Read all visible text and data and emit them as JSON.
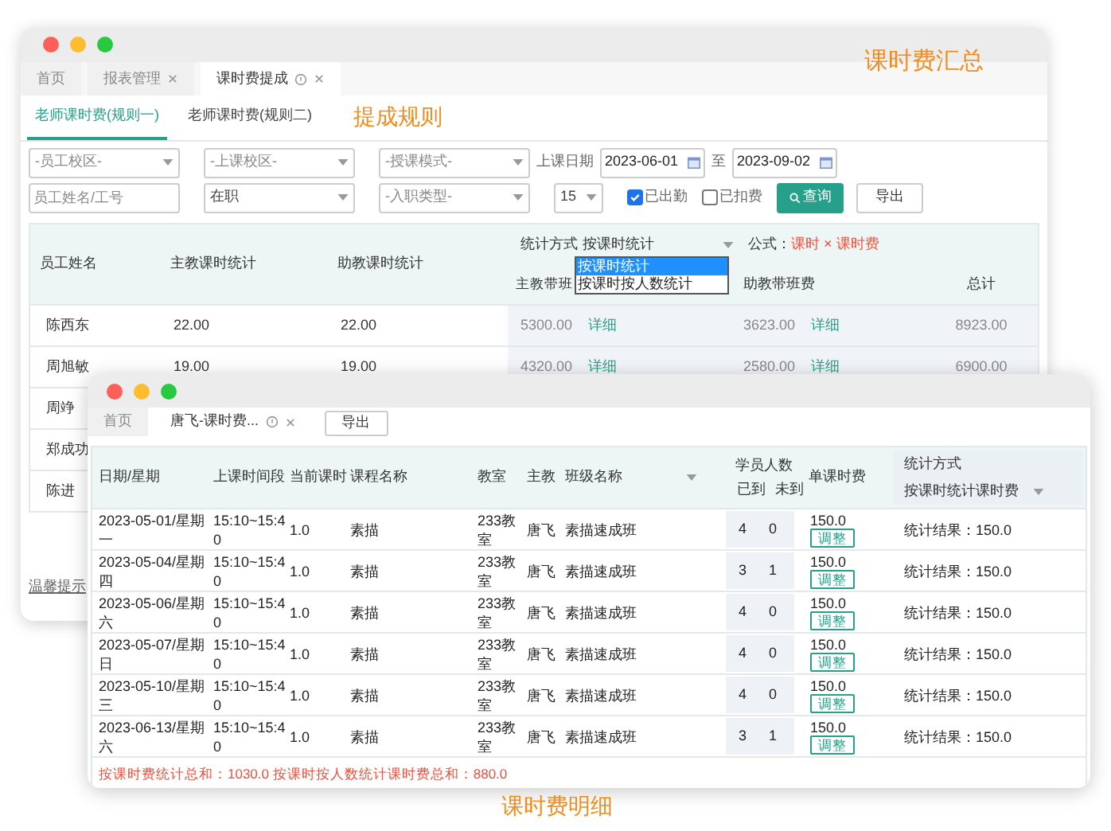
{
  "captions": {
    "summary": "课时费汇总",
    "rules": "提成规则",
    "detail": "课时费明细"
  },
  "summary_window": {
    "tabs": [
      {
        "label": "首页",
        "selected": false,
        "closable": false,
        "info": false
      },
      {
        "label": "报表管理",
        "selected": false,
        "closable": true,
        "info": false
      },
      {
        "label": "课时费提成",
        "selected": true,
        "closable": true,
        "info": true
      }
    ],
    "rule_tabs": [
      {
        "label": "老师课时费(规则一)",
        "selected": true
      },
      {
        "label": "老师课时费(规则二)",
        "selected": false
      }
    ],
    "filter_rows": [
      [
        {
          "kind": "select",
          "placeholder": "-员工校区-"
        },
        {
          "kind": "select",
          "placeholder": "-上课校区-"
        },
        {
          "kind": "select",
          "placeholder": "-授课模式-"
        },
        {
          "kind": "label",
          "text": "上课日期"
        },
        {
          "kind": "date",
          "value": "2023-06-01"
        },
        {
          "kind": "label",
          "text": "至"
        },
        {
          "kind": "date",
          "value": "2023-09-02"
        }
      ],
      [
        {
          "kind": "input",
          "placeholder": "员工姓名/工号"
        },
        {
          "kind": "select",
          "value": "在职"
        },
        {
          "kind": "select",
          "placeholder": "-入职类型-"
        },
        {
          "kind": "small_select",
          "value": "15"
        },
        {
          "kind": "checkbox",
          "text": "已出勤",
          "checked": true
        },
        {
          "kind": "checkbox",
          "text": "已扣费",
          "checked": false
        },
        {
          "kind": "primary_button",
          "text": "查询"
        },
        {
          "kind": "button",
          "text": "导出"
        }
      ]
    ],
    "table": {
      "columns": [
        "员工姓名",
        "主教课时统计",
        "助教课时统计"
      ],
      "stat_label": "统计方式",
      "stat_value": "按课时统计",
      "stat_options": [
        {
          "label": "按课时统计",
          "selected": true
        },
        {
          "label": "按课时按人数统计",
          "selected": false
        }
      ],
      "formula_label": "公式：",
      "formula": "课时 × 课时费",
      "fee_columns": [
        "主教带班",
        "助教带班费",
        "总计"
      ],
      "rows": [
        {
          "name": "陈西东",
          "main_hours": "22.00",
          "assist_hours": "22.00",
          "main_fee": "5300.00",
          "main_link": "详细",
          "assist_fee": "3623.00",
          "assist_link": "详细",
          "total": "8923.00"
        },
        {
          "name": "周旭敏",
          "main_hours": "19.00",
          "assist_hours": "19.00",
          "main_fee": "4320.00",
          "main_link": "详细",
          "assist_fee": "2580.00",
          "assist_link": "详细",
          "total": "6900.00"
        },
        {
          "name": "周竫"
        },
        {
          "name": "郑成功"
        },
        {
          "name": "陈进"
        }
      ]
    },
    "tip": "温馨提示"
  },
  "detail_window": {
    "tabs": [
      {
        "label": "首页",
        "selected": false,
        "closable": false,
        "info": false
      },
      {
        "label": "唐飞-课时费...",
        "selected": true,
        "closable": true,
        "info": true
      }
    ],
    "export_button": "导出",
    "columns": [
      "日期/星期",
      "上课时间段",
      "当前课时",
      "课程名称",
      "教室",
      "主教",
      "班级名称"
    ],
    "students_label": "学员人数",
    "present_label": "已到",
    "absent_label": "未到",
    "fee_label": "单课时费",
    "stat_label": "统计方式",
    "stat_value": "按课时统计课时费",
    "rows": [
      {
        "date": "2023-05-01/星期一",
        "time": "15:10~15:40",
        "hours": "1.0",
        "course": "素描",
        "room": "233教室",
        "teacher": "唐飞",
        "class": "素描速成班",
        "present": "4",
        "absent": "0",
        "fee": "150.0",
        "adjust": "调整",
        "result": "统计结果：150.0"
      },
      {
        "date": "2023-05-04/星期四",
        "time": "15:10~15:40",
        "hours": "1.0",
        "course": "素描",
        "room": "233教室",
        "teacher": "唐飞",
        "class": "素描速成班",
        "present": "3",
        "absent": "1",
        "fee": "150.0",
        "adjust": "调整",
        "result": "统计结果：150.0"
      },
      {
        "date": "2023-05-06/星期六",
        "time": "15:10~15:40",
        "hours": "1.0",
        "course": "素描",
        "room": "233教室",
        "teacher": "唐飞",
        "class": "素描速成班",
        "present": "4",
        "absent": "0",
        "fee": "150.0",
        "adjust": "调整",
        "result": "统计结果：150.0"
      },
      {
        "date": "2023-05-07/星期日",
        "time": "15:10~15:40",
        "hours": "1.0",
        "course": "素描",
        "room": "233教室",
        "teacher": "唐飞",
        "class": "素描速成班",
        "present": "4",
        "absent": "0",
        "fee": "150.0",
        "adjust": "调整",
        "result": "统计结果：150.0"
      },
      {
        "date": "2023-05-10/星期三",
        "time": "15:10~15:40",
        "hours": "1.0",
        "course": "素描",
        "room": "233教室",
        "teacher": "唐飞",
        "class": "素描速成班",
        "present": "4",
        "absent": "0",
        "fee": "150.0",
        "adjust": "调整",
        "result": "统计结果：150.0"
      },
      {
        "date": "2023-06-13/星期六",
        "time": "15:10~15:40",
        "hours": "1.0",
        "course": "素描",
        "room": "233教室",
        "teacher": "唐飞",
        "class": "素描速成班",
        "present": "3",
        "absent": "1",
        "fee": "150.0",
        "adjust": "调整",
        "result": "统计结果：150.0"
      }
    ],
    "footer": "按课时费统计总和：1030.0 按课时按人数统计课时费总和：880.0"
  }
}
